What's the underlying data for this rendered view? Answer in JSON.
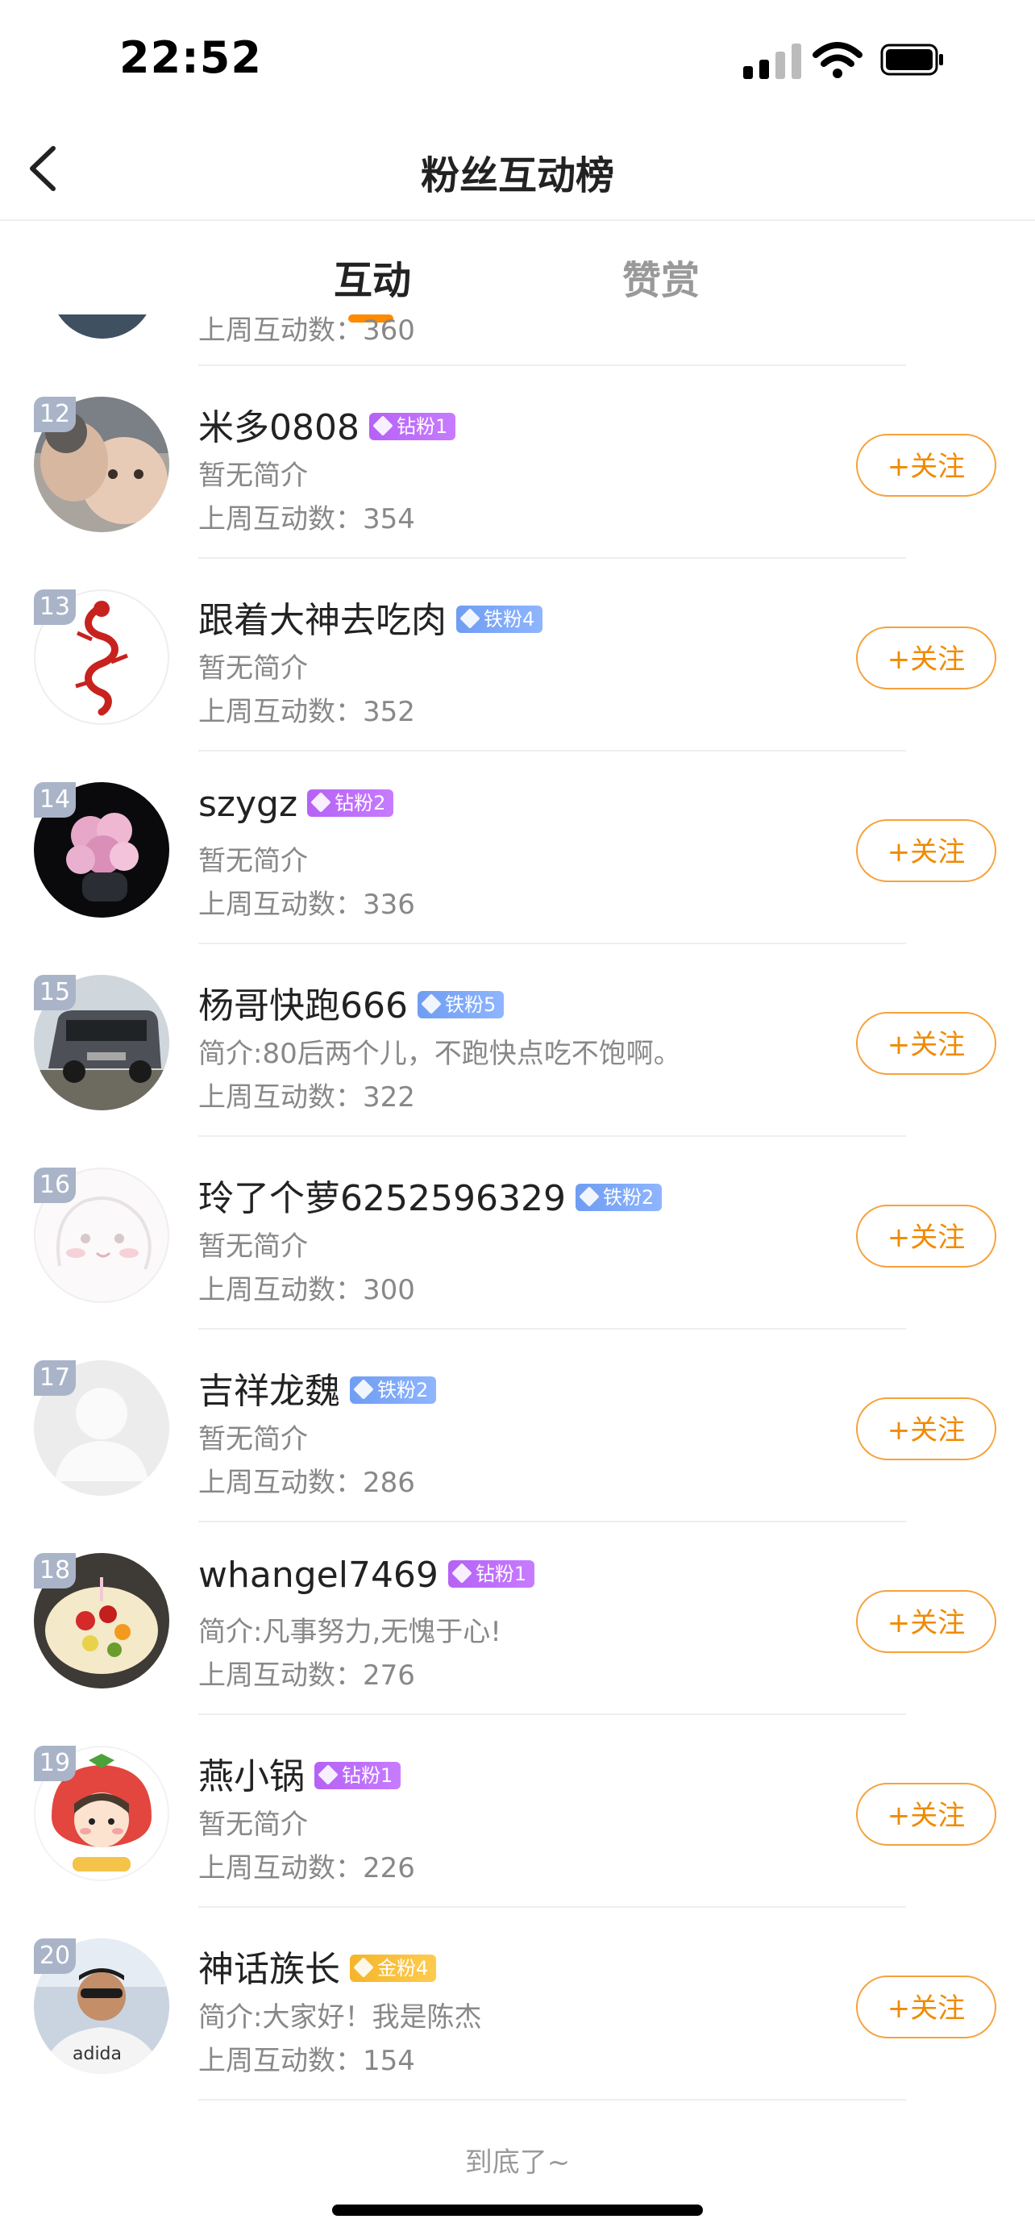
{
  "status_bar": {
    "time": "22:52"
  },
  "nav": {
    "title": "粉丝互动榜"
  },
  "tabs": [
    {
      "label": "互动",
      "active": true
    },
    {
      "label": "赞赏",
      "active": false
    }
  ],
  "partial_row": {
    "count_text": "上周互动数：360"
  },
  "rows": [
    {
      "rank": "12",
      "name": "米多0808",
      "badge": "钻粉1",
      "badge_type": "diamond",
      "intro": "暂无简介",
      "count": "上周互动数：354",
      "follow": "+关注"
    },
    {
      "rank": "13",
      "name": "跟着大神去吃肉",
      "badge": "铁粉4",
      "badge_type": "iron",
      "intro": "暂无简介",
      "count": "上周互动数：352",
      "follow": "+关注"
    },
    {
      "rank": "14",
      "name": "szygz",
      "badge": "钻粉2",
      "badge_type": "diamond",
      "intro": "暂无简介",
      "count": "上周互动数：336",
      "follow": "+关注"
    },
    {
      "rank": "15",
      "name": "杨哥快跑666",
      "badge": "铁粉5",
      "badge_type": "iron",
      "intro": "简介:80后两个儿，不跑快点吃不饱啊。",
      "count": "上周互动数：322",
      "follow": "+关注"
    },
    {
      "rank": "16",
      "name": "玲了个萝6252596329",
      "badge": "铁粉2",
      "badge_type": "iron",
      "intro": "暂无简介",
      "count": "上周互动数：300",
      "follow": "+关注"
    },
    {
      "rank": "17",
      "name": "吉祥龙魏",
      "badge": "铁粉2",
      "badge_type": "iron",
      "intro": "暂无简介",
      "count": "上周互动数：286",
      "follow": "+关注"
    },
    {
      "rank": "18",
      "name": "whangel7469",
      "badge": "钻粉1",
      "badge_type": "diamond",
      "intro": "简介:凡事努力,无愧于心!",
      "count": "上周互动数：276",
      "follow": "+关注"
    },
    {
      "rank": "19",
      "name": "燕小锅",
      "badge": "钻粉1",
      "badge_type": "diamond",
      "intro": "暂无简介",
      "count": "上周互动数：226",
      "follow": "+关注"
    },
    {
      "rank": "20",
      "name": "神话族长",
      "badge": "金粉4",
      "badge_type": "gold",
      "intro": "简介:大家好！我是陈杰",
      "count": "上周互动数：154",
      "follow": "+关注"
    }
  ],
  "footer": {
    "text": "到底了~"
  },
  "colors": {
    "accent": "#ff8a00",
    "diamond": "#b562f5",
    "iron": "#6f9df2",
    "gold": "#f5b52a"
  }
}
